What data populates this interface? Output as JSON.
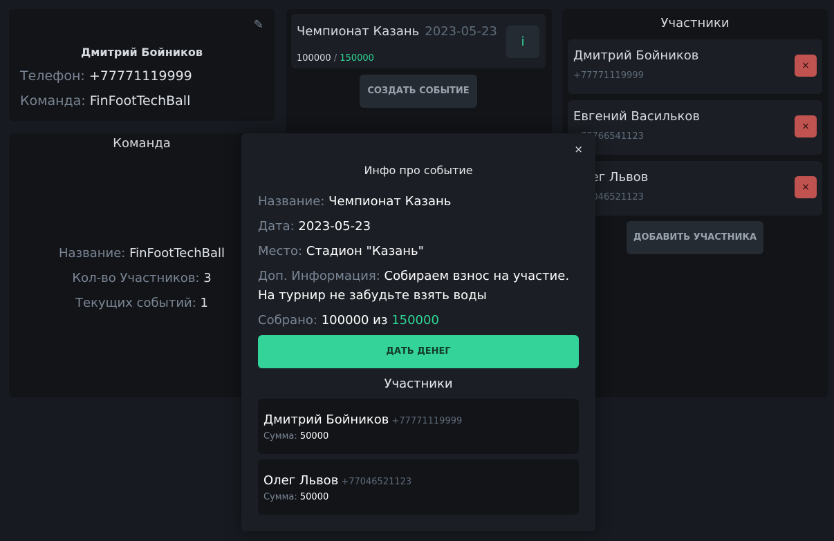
{
  "profile": {
    "name": "Дмитрий Бойников",
    "phone_label": "Телефон:",
    "phone": "+77771119999",
    "team_label": "Команда:",
    "team": "FinFootTechBall",
    "edit_icon": "pencil-icon",
    "edit_glyph": "✎"
  },
  "team": {
    "title": "Команда",
    "name_label": "Название:",
    "name": "FinFootTechBall",
    "members_label": "Кол-во Участников:",
    "members": "3",
    "events_label": "Текущих событий:",
    "events": "1"
  },
  "events": {
    "items": [
      {
        "name": "Чемпионат Казань",
        "date": "2023-05-23",
        "collected": "100000",
        "separator": " / ",
        "goal": "150000",
        "info_label": "i"
      }
    ],
    "create_label": "СОЗДАТЬ СОБЫТИЕ"
  },
  "participants": {
    "title": "Участники",
    "items": [
      {
        "name": "Дмитрий Бойников",
        "phone": "+77771119999"
      },
      {
        "name": "Евгений Васильков",
        "phone": "+77766541123"
      },
      {
        "name": "Олег Львов",
        "phone": "+77046521123"
      }
    ],
    "delete_glyph": "×",
    "add_label": "ДОБАВИТЬ УЧАСТНИКА"
  },
  "modal": {
    "close_glyph": "×",
    "title": "Инфо про событие",
    "name_label": "Название:",
    "name": "Чемпионат Казань",
    "date_label": "Дата:",
    "date": "2023-05-23",
    "place_label": "Место:",
    "place": "Стадион \"Казань\"",
    "extra_label": "Доп. Информация:",
    "extra": "Собираем взнос на участие. На турнир не забудьте взять воды",
    "collected_label": "Собрано:",
    "collected": "100000",
    "of_word": "из",
    "goal": "150000",
    "give_label": "ДАТЬ ДЕНЕГ",
    "participants_title": "Участники",
    "sum_label": "Сумма:",
    "participants": [
      {
        "name": "Дмитрий Бойников",
        "phone": "+77771119999",
        "sum": "50000"
      },
      {
        "name": "Олег Львов",
        "phone": "+77046521123",
        "sum": "50000"
      }
    ]
  },
  "colors": {
    "background": "#171b21",
    "panel": "#121418",
    "card": "#1b1f25",
    "accent_green": "#34d39a",
    "danger": "#c0524f"
  }
}
